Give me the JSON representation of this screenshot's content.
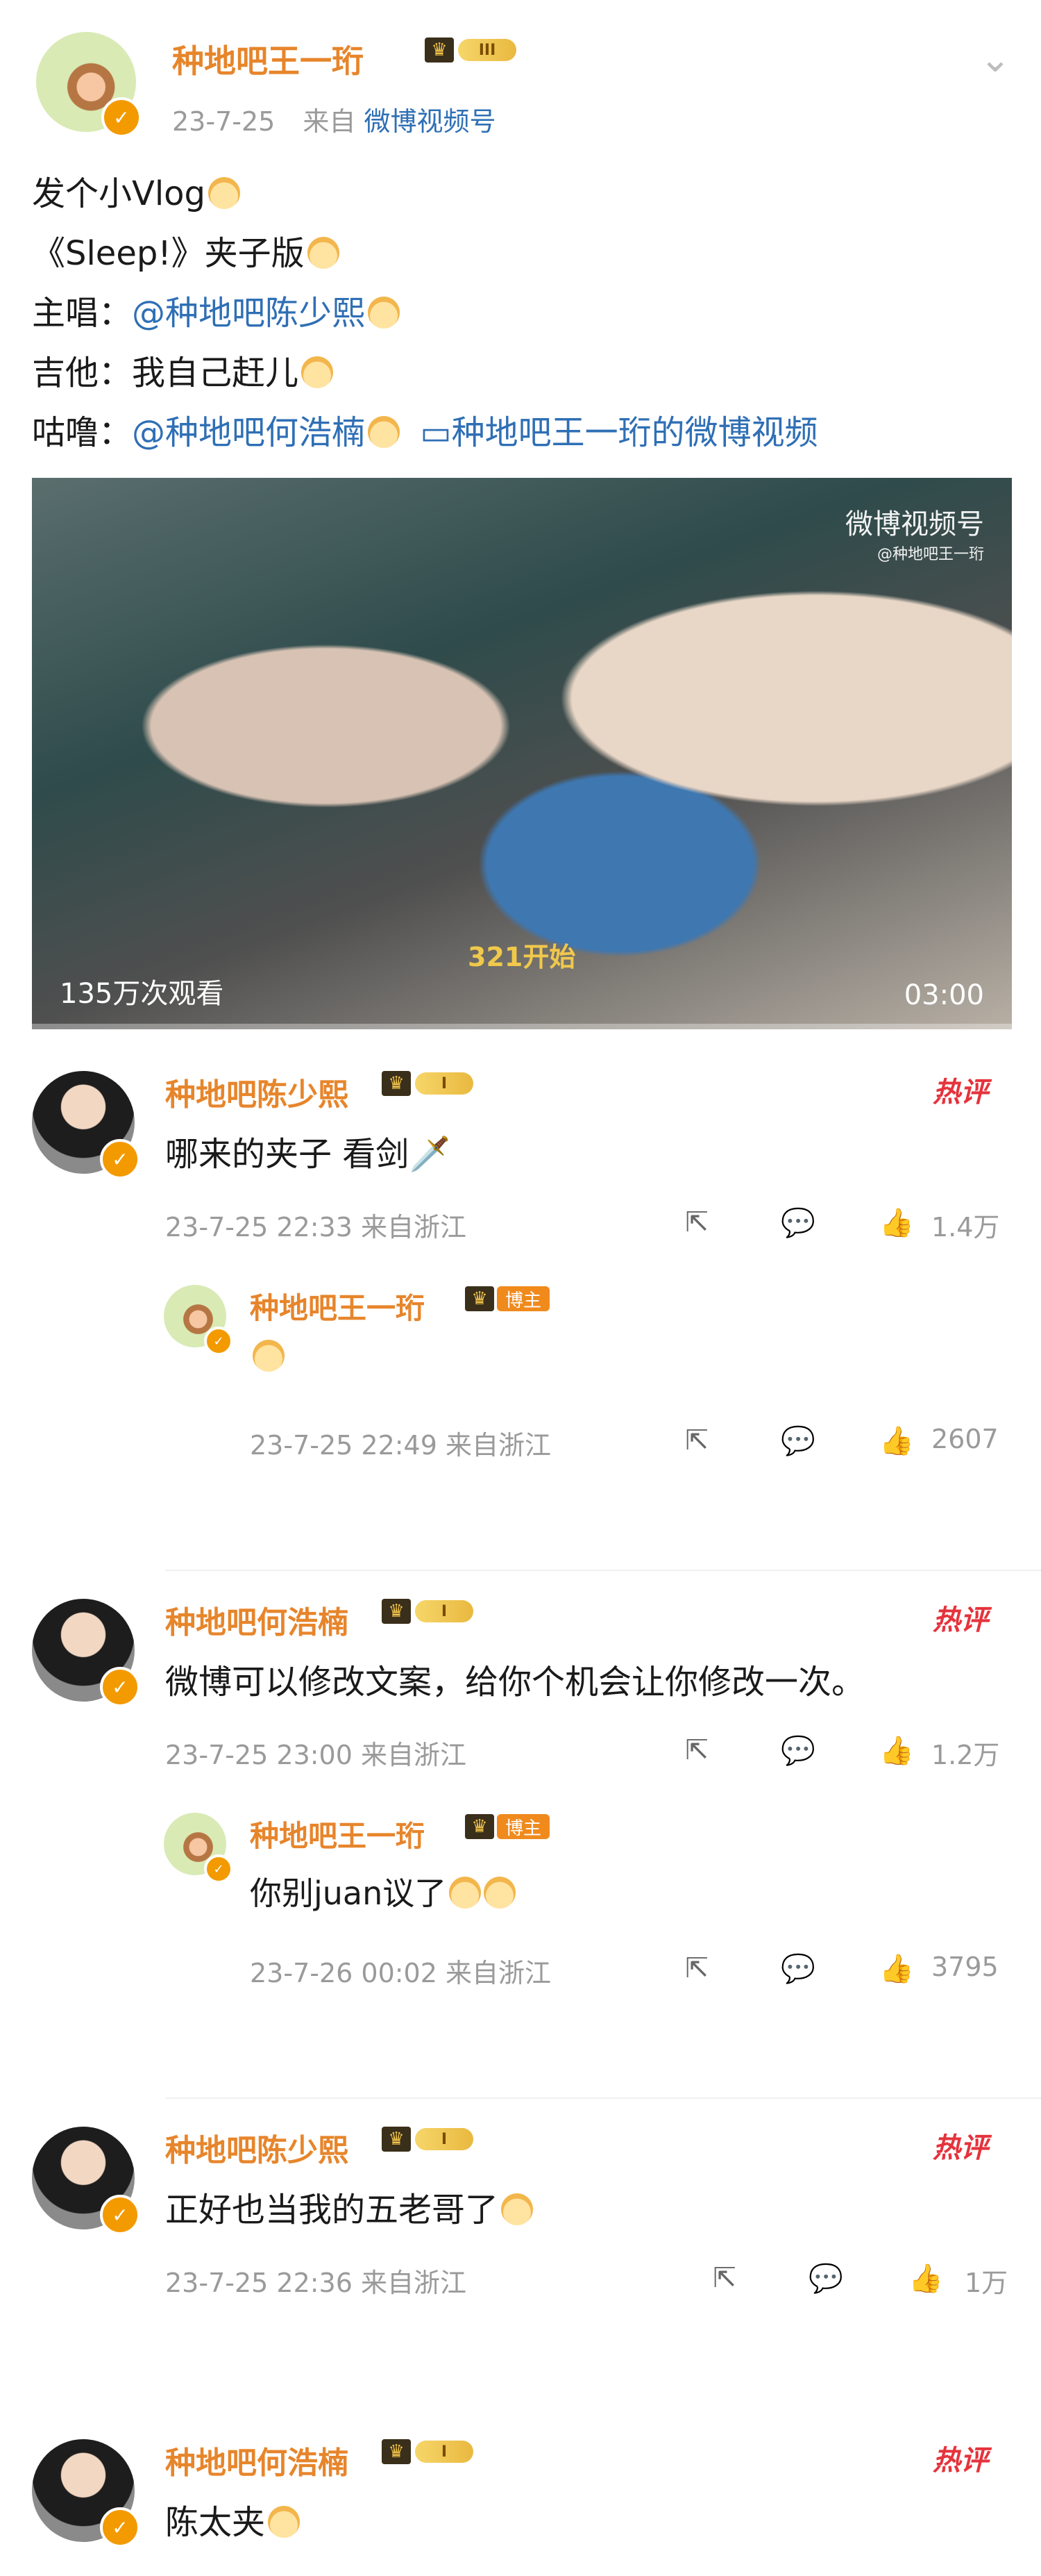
{
  "post": {
    "author": "种地吧王一珩",
    "level_badge": "III",
    "date": "23-7-25",
    "source_prefix": "来自",
    "source": "微博视频号",
    "lines": [
      {
        "label": "发个小Vlog",
        "mention": ""
      },
      {
        "label": "《Sleep!》夹子版",
        "mention": ""
      },
      {
        "label": "主唱：",
        "mention": "@种地吧陈少熙"
      },
      {
        "label": "吉他：我自己赶儿",
        "mention": ""
      },
      {
        "label": "咕噜：",
        "mention": "@种地吧何浩楠"
      }
    ],
    "video_link": "种地吧王一珩的微博视频"
  },
  "video": {
    "watermark": "微博视频号",
    "watermark_sub": "@种地吧王一珩",
    "views": "135万次观看",
    "duration": "03:00",
    "subtitle": "321开始",
    "progress": 0.0
  },
  "comments": [
    {
      "name": "种地吧陈少熙",
      "badge": "I",
      "hot": "热评",
      "text": "哪来的夹子 看剑🗡️",
      "time": "23-7-25 22:33 来自浙江",
      "likes": "1.4万",
      "reply": {
        "name": "种地吧王一珩",
        "badge_tag": "博主",
        "text": "",
        "time": "23-7-25 22:49 来自浙江",
        "likes": "2607"
      }
    },
    {
      "name": "种地吧何浩楠",
      "badge": "I",
      "hot": "热评",
      "text": "微博可以修改文案，给你个机会让你修改一次。",
      "time": "23-7-25 23:00 来自浙江",
      "likes": "1.2万",
      "reply": {
        "name": "种地吧王一珩",
        "badge_tag": "博主",
        "text": "你别juan议了",
        "time": "23-7-26 00:02 来自浙江",
        "likes": "3795"
      }
    },
    {
      "name": "种地吧陈少熙",
      "badge": "I",
      "hot": "热评",
      "text": "正好也当我的五老哥了",
      "time": "23-7-25 22:36 来自浙江",
      "likes": "1万"
    },
    {
      "name": "种地吧何浩楠",
      "badge": "I",
      "hot": "热评",
      "text": "陈太夹"
    }
  ],
  "icons": {
    "share": "share-icon",
    "comment": "comment-icon",
    "like": "like-icon",
    "chevron": "chevron-down-icon",
    "video_link": "video-link-icon"
  },
  "colors": {
    "name": "#e7852b",
    "link": "#2f6fb5",
    "hot": "#e5333c",
    "meta": "#9a9a9a"
  }
}
